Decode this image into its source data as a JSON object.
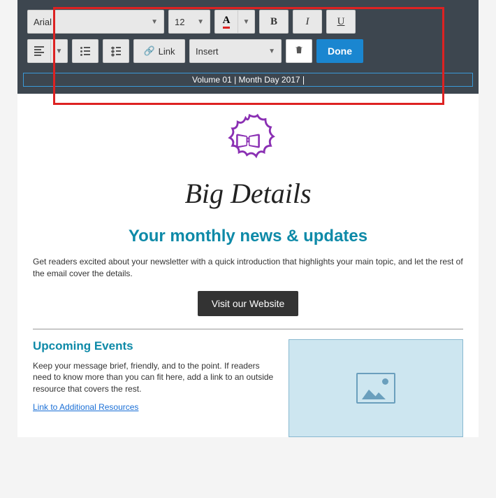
{
  "toolbar": {
    "font_family": "Arial",
    "font_size": "12",
    "link_label": "Link",
    "insert_label": "Insert",
    "done_label": "Done"
  },
  "editing_text": "Volume 01 | Month Day 2017",
  "brand_name": "Big Details",
  "headline": "Your monthly news & updates",
  "intro_text": "Get readers excited about your newsletter with a quick introduction that highlights your main topic, and let the rest of the email cover the details.",
  "cta_label": "Visit our Website",
  "section": {
    "title": "Upcoming Events",
    "body": "Keep your message brief, friendly, and to the point. If readers need to know more than you can fit here, add a link to an outside resource that covers the rest.",
    "link_label": "Link to Additional Resources"
  }
}
